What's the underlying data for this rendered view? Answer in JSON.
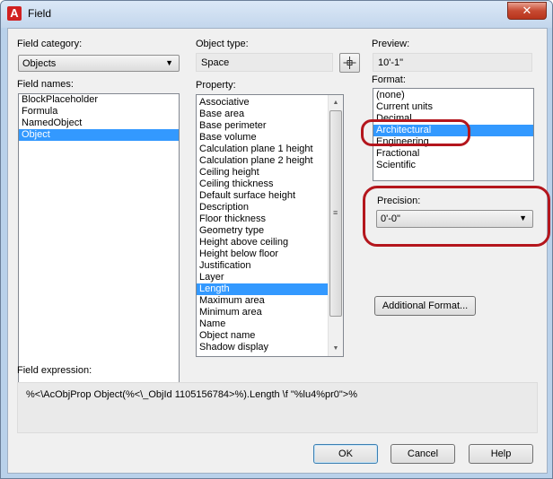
{
  "window": {
    "title": "Field",
    "close_glyph": "✕"
  },
  "field_category": {
    "label": "Field category:",
    "value": "Objects"
  },
  "field_names": {
    "label": "Field names:",
    "items": [
      "BlockPlaceholder",
      "Formula",
      "NamedObject",
      "Object"
    ],
    "selected": "Object"
  },
  "object_type": {
    "label": "Object type:",
    "value": "Space"
  },
  "property": {
    "label": "Property:",
    "items": [
      "Associative",
      "Base area",
      "Base perimeter",
      "Base volume",
      "Calculation plane 1 height",
      "Calculation plane 2 height",
      "Ceiling height",
      "Ceiling thickness",
      "Default surface height",
      "Description",
      "Floor thickness",
      "Geometry type",
      "Height above ceiling",
      "Height below floor",
      "Justification",
      "Layer",
      "Length",
      "Maximum area",
      "Minimum area",
      "Name",
      "Object name",
      "Shadow display"
    ],
    "selected": "Length",
    "scroll_grip": "≡"
  },
  "preview": {
    "label": "Preview:",
    "value": "10'-1\""
  },
  "format": {
    "label": "Format:",
    "items": [
      "(none)",
      "Current units",
      "Decimal",
      "Architectural",
      "Engineering",
      "Fractional",
      "Scientific"
    ],
    "selected": "Architectural"
  },
  "precision": {
    "label": "Precision:",
    "value": "0'-0\""
  },
  "additional_format": {
    "label": "Additional Format..."
  },
  "field_expression": {
    "label": "Field expression:",
    "value": "%<\\AcObjProp Object(%<\\_ObjId 1105156784>%).Length \\f \"%lu4%pr0\">%"
  },
  "buttons": {
    "ok": "OK",
    "cancel": "Cancel",
    "help": "Help"
  },
  "colors": {
    "selection": "#3399ff",
    "annotation": "#b4161d",
    "close_button": "#c74a32"
  },
  "icons": [
    "app-icon",
    "close-icon",
    "pick-object-icon",
    "dropdown-arrow-icon",
    "scroll-up-icon",
    "scroll-down-icon"
  ]
}
